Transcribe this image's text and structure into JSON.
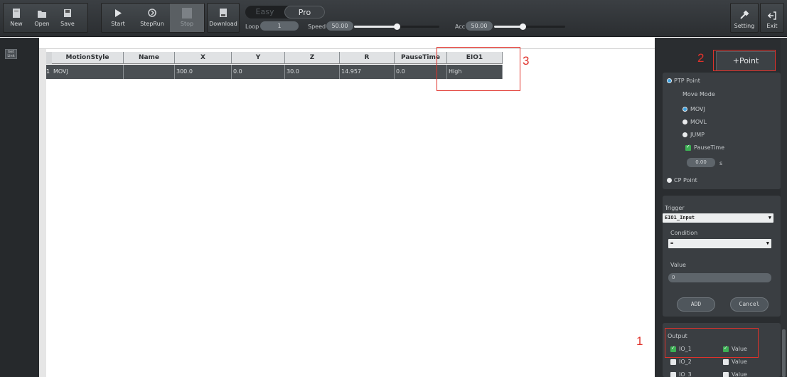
{
  "toolbar": {
    "file_buttons": [
      {
        "label": "New",
        "icon": "new-file-icon"
      },
      {
        "label": "Open",
        "icon": "open-folder-icon"
      },
      {
        "label": "Save",
        "icon": "save-icon"
      }
    ],
    "run_buttons": [
      {
        "label": "Start",
        "icon": "play-icon"
      },
      {
        "label": "StepRun",
        "icon": "step-run-icon"
      },
      {
        "label": "Stop",
        "icon": "stop-icon",
        "disabled": true
      }
    ],
    "download_label": "Download",
    "mode_easy": "Easy",
    "mode_pro": "Pro",
    "loop_label": "Loop",
    "loop_value": "1",
    "speed_label": "Speed",
    "speed_value": "50.00",
    "speed_level": 0.5,
    "acc_label": "Acc",
    "acc_value": "50.00",
    "acc_level": 0.5,
    "setting_label": "Setting",
    "exit_label": "Exit"
  },
  "left_strip": {
    "mini_label": "Get Link"
  },
  "table": {
    "columns": [
      "MotionStyle",
      "Name",
      "X",
      "Y",
      "Z",
      "R",
      "PauseTime",
      "EIO1"
    ],
    "rows": [
      {
        "num": "1",
        "cells": [
          "MOVJ",
          "",
          "300.0",
          "0.0",
          "30.0",
          "14.957",
          "0.0",
          "High"
        ]
      }
    ]
  },
  "annotations": {
    "one": "1",
    "two": "2",
    "three": "3"
  },
  "right_panel": {
    "add_point_label": "+Point",
    "ptp_label": "PTP Point",
    "move_mode_label": "Move Mode",
    "modes": [
      "MOVJ",
      "MOVL",
      "JUMP"
    ],
    "pause_time_label": "PauseTime",
    "pause_value": "0.00",
    "pause_unit": "s",
    "cp_label": "CP Point",
    "trigger_label": "Trigger",
    "trigger_value": "EIO1_Input",
    "condition_label": "Condition",
    "condition_value": "=",
    "value_label": "Value",
    "value_value": "0",
    "add_label": "ADD",
    "cancel_label": "Cancel",
    "output_label": "Output",
    "outputs": [
      {
        "io": "IO_1",
        "value_label": "Value"
      },
      {
        "io": "IO_2",
        "value_label": "Value"
      },
      {
        "io": "IO_3",
        "value_label": "Value"
      }
    ]
  },
  "colors": {
    "accent": "#3fa2e0",
    "annotation_red": "#e0322b",
    "check_green": "#3cb054"
  }
}
